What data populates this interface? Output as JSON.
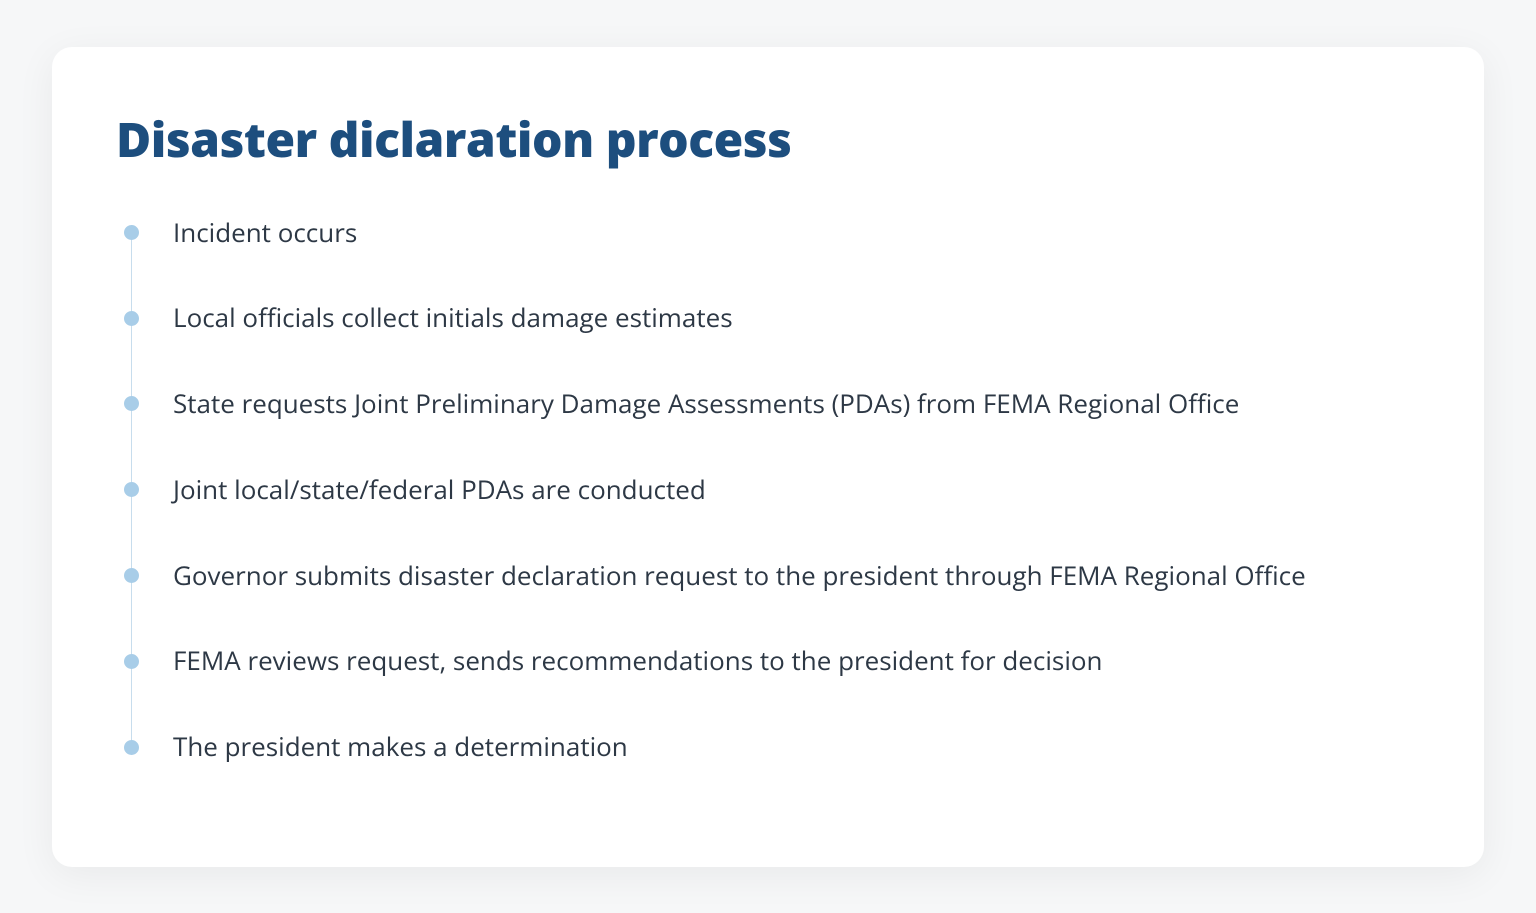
{
  "title": "Disaster diclaration process",
  "steps": [
    "Incident occurs",
    "Local officials collect initials damage estimates",
    "State requests Joint Preliminary Damage Assessments (PDAs) from FEMA Regional Office",
    "Joint local/state/federal PDAs are conducted",
    "Governor submits disaster declaration request to the president through FEMA Regional Office",
    "FEMA reviews request, sends recommendations to the president for decision",
    "The president makes a determination"
  ]
}
